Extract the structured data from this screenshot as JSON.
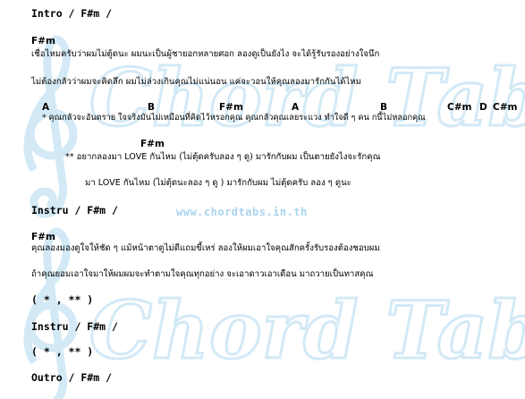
{
  "colors": {
    "text": "#000000",
    "watermark": "#d3e9f6",
    "url": "#a9d4ee"
  },
  "watermark": {
    "line1": "Chord Tabs",
    "line2": "Chord Tabs",
    "url": "www.chordtabs.in.th"
  },
  "sheet": {
    "intro_header": "Intro  / F#m /",
    "verse_chord": "F#m",
    "verse_line1": "เชื่อไหมครับว่าผมไม่ตู้ดนะ ผมนะเป็นผู้ชายอกหลายศอก ลองดูเป็นยังไง จะได้รู้รับรองอย่างใจนึก",
    "verse_line2": "ไม่ต้องกลัวว่าผมจะคิดลึก ผมไม่ล่วงเกินคุณไม่แน่นอน แค่จะวอนให้คุณลองมารักกันได้ไหม",
    "pre_chords": {
      "a1": "A",
      "b1": "B",
      "fsm": "F#m",
      "a2": "A",
      "b2": "B",
      "csm1": "C#m",
      "d": "D",
      "csm2": "C#m"
    },
    "pre_line": "* คุณกลัวจะอันตราย ใจจริงมันไม่เหมือนที่คิดไว้หรอกคุณ คุณกลัวคุณเลยระแวง ทำใจดี ๆ คน กนี้ไม่หลอกคุณ",
    "hook_chord": "F#m",
    "hook_line1": "**  อยากลองมา LOVE กันไหม (ไม่ตุ้ดครับลอง ๆ ดู) มารักกับผม  เป็นตายยังไงจะรักคุณ",
    "hook_line2": "มา LOVE กันไหม (ไม่ตุ้ดนะลอง ๆ ดู ) มารักกับผม ไม่ตุ้ดครับ ลอง ๆ ดูนะ",
    "instru1_header": "Instru  / F#m /",
    "verse2_chord": "F#m",
    "verse2_line1": "คุณลองมองดูใจให้ชัด ๆ แม้หน้าตาดูไม่ดีแถมขี้เหร่ ลองให้ผมเอาใจคุณสักครั้งรับรองต้องชอบผม",
    "verse2_line2": "ถ้าคุณยอมเอาใจมาให้ผมผมจะทำตามใจคุณทุกอย่าง จะเอาดาวเอาเดือน  มาถวายเป็นทาสคุณ",
    "repeat1": "( * , ** )",
    "instru2_header": "Instru  / F#m /",
    "repeat2": "( * , ** )",
    "outro_header": "Outro  / F#m /"
  }
}
